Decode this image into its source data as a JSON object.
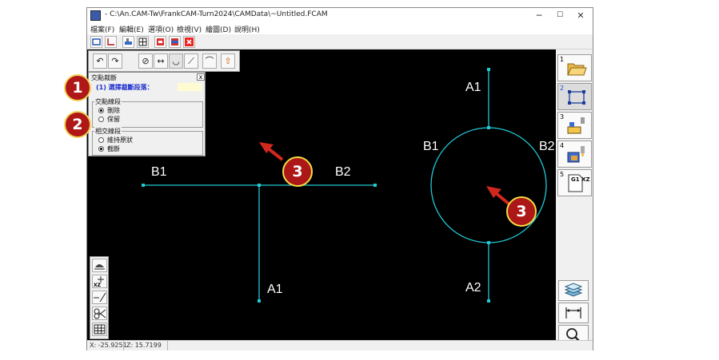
{
  "window": {
    "title": "- C:\\An.CAM-Tw\\FrankCAM-Turn2024\\CAMData\\~Untitled.FCAM",
    "minimize": "─",
    "maximize": "☐",
    "close": "✕"
  },
  "menu": [
    "檔案(F)",
    "編輯(E)",
    "選項(O)",
    "檢視(V)",
    "繪圖(D)",
    "說明(H)"
  ],
  "toolbar1_icons": [
    "rect-tool-icon",
    "axis-icon",
    "lathe-icon",
    "grid-icon",
    "nc-red-icon",
    "nc-blue-icon",
    "close-red-icon"
  ],
  "toolbar2_icons": [
    "undo-icon",
    "redo-icon",
    "trim-icon",
    "extend-icon",
    "fillet-curve-icon",
    "slope-icon",
    "arc-icon",
    "upload-icon"
  ],
  "panel": {
    "title": "交點裁斷",
    "close": "x",
    "prompt": "(1) 選擇裁斷段落：",
    "group1": {
      "title": "交點線段",
      "options": [
        "刪除",
        "保留"
      ],
      "selected": 0
    },
    "group2": {
      "title": "相交線段",
      "options": [
        "維持原狀",
        "截斷"
      ],
      "selected": 1
    }
  },
  "drawing": {
    "left_labels": {
      "b1": "B1",
      "b2": "B2",
      "a1": "A1"
    },
    "right_labels": {
      "a1": "A1",
      "b1": "B1",
      "b2": "B2",
      "a2": "A2"
    },
    "line_color": "#21c9d4"
  },
  "markers": {
    "m1": "1",
    "m2": "2",
    "m3a": "3",
    "m3b": "3"
  },
  "right_toolbar": [
    {
      "num": "1",
      "icon": "folder-open-icon"
    },
    {
      "num": "2",
      "icon": "rectangle-select-icon"
    },
    {
      "num": "3",
      "icon": "tool-path-icon"
    },
    {
      "num": "4",
      "icon": "tool-holder-icon"
    },
    {
      "num": "5",
      "icon": "gcode-icon",
      "text": "G1 XZ"
    }
  ],
  "right_bottom_toolbar": [
    "layers-icon",
    "measure-icon",
    "zoom-icon"
  ],
  "left_toolbar": [
    "view-icon",
    "xz-axis-icon",
    "line-icon",
    "scissors-icon",
    "grid-icon"
  ],
  "status": {
    "x": "X: -25.9251",
    "z": "Z: 15.7199"
  }
}
